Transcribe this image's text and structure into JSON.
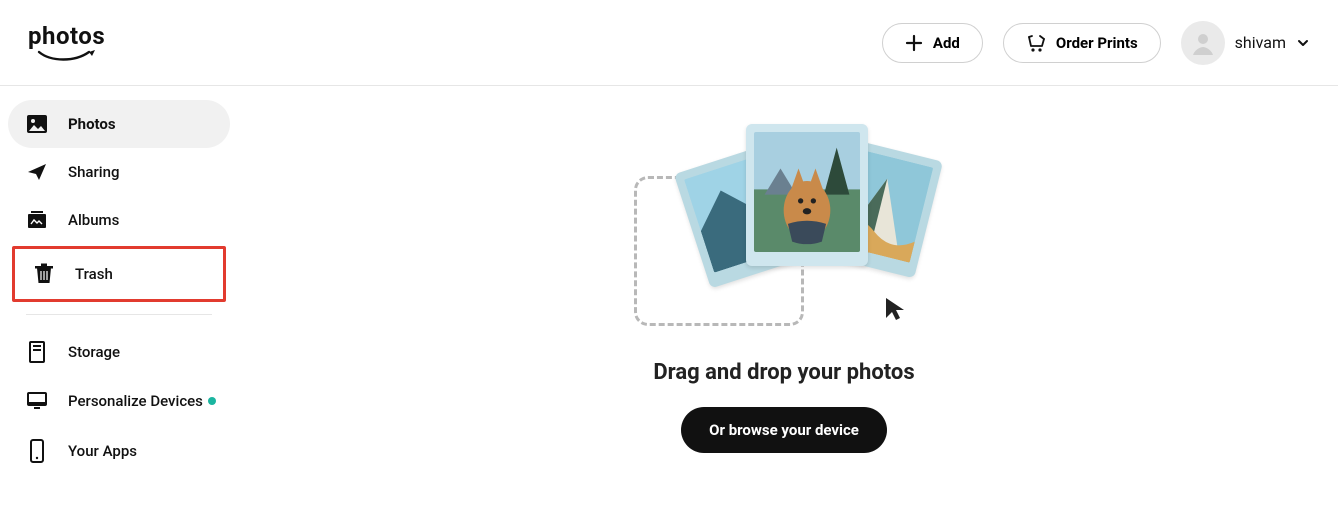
{
  "header": {
    "logo_text": "photos",
    "add_label": "Add",
    "order_prints_label": "Order Prints",
    "user_name": "shivam"
  },
  "sidebar": {
    "items": [
      {
        "label": "Photos",
        "icon": "photo-icon",
        "active": true
      },
      {
        "label": "Sharing",
        "icon": "send-icon"
      },
      {
        "label": "Albums",
        "icon": "albums-icon"
      },
      {
        "label": "Trash",
        "icon": "trash-icon",
        "highlighted": true
      }
    ],
    "items2": [
      {
        "label": "Storage",
        "icon": "storage-icon"
      },
      {
        "label": "Personalize Devices",
        "icon": "monitor-icon",
        "dot": true
      },
      {
        "label": "Your Apps",
        "icon": "phone-icon"
      }
    ]
  },
  "main": {
    "heading": "Drag and drop your photos",
    "browse_label": "Or browse your device"
  }
}
